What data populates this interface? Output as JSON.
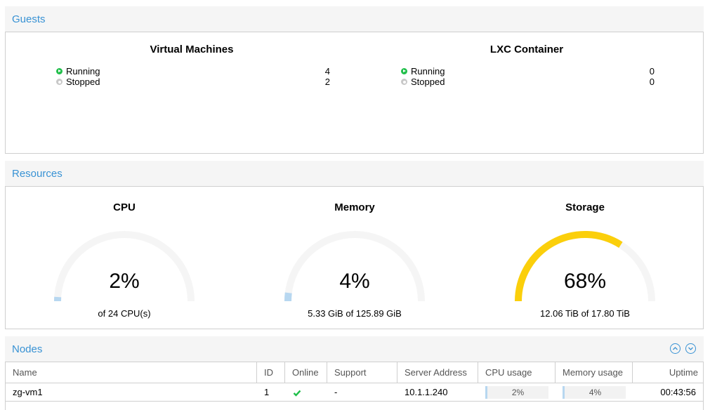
{
  "guests": {
    "title": "Guests",
    "vm": {
      "title": "Virtual Machines",
      "running_label": "Running",
      "running_count": "4",
      "stopped_label": "Stopped",
      "stopped_count": "2"
    },
    "lxc": {
      "title": "LXC Container",
      "running_label": "Running",
      "running_count": "0",
      "stopped_label": "Stopped",
      "stopped_count": "0"
    }
  },
  "resources": {
    "title": "Resources",
    "cpu": {
      "title": "CPU",
      "value": "2%",
      "fraction": 0.02,
      "sub": "of 24 CPU(s)",
      "color": "#b7d7f0"
    },
    "memory": {
      "title": "Memory",
      "value": "4%",
      "fraction": 0.04,
      "sub": "5.33 GiB of 125.89 GiB",
      "color": "#b7d7f0"
    },
    "storage": {
      "title": "Storage",
      "value": "68%",
      "fraction": 0.68,
      "sub": "12.06 TiB of 17.80 TiB",
      "color": "#fbcf0b"
    }
  },
  "nodes": {
    "title": "Nodes",
    "columns": [
      "Name",
      "ID",
      "Online",
      "Support",
      "Server Address",
      "CPU usage",
      "Memory usage",
      "Uptime"
    ],
    "rows": [
      {
        "name": "zg-vm1",
        "id": "1",
        "online": "check-icon",
        "support": "-",
        "address": "10.1.1.240",
        "cpu": "2%",
        "cpu_fraction": 0.02,
        "memory": "4%",
        "memory_fraction": 0.04,
        "uptime": "00:43:56"
      }
    ]
  },
  "colors": {
    "accent": "#3892d4",
    "running": "#21bf4b",
    "stopped": "#c8c8c8",
    "gauge_track": "#f5f5f5"
  }
}
